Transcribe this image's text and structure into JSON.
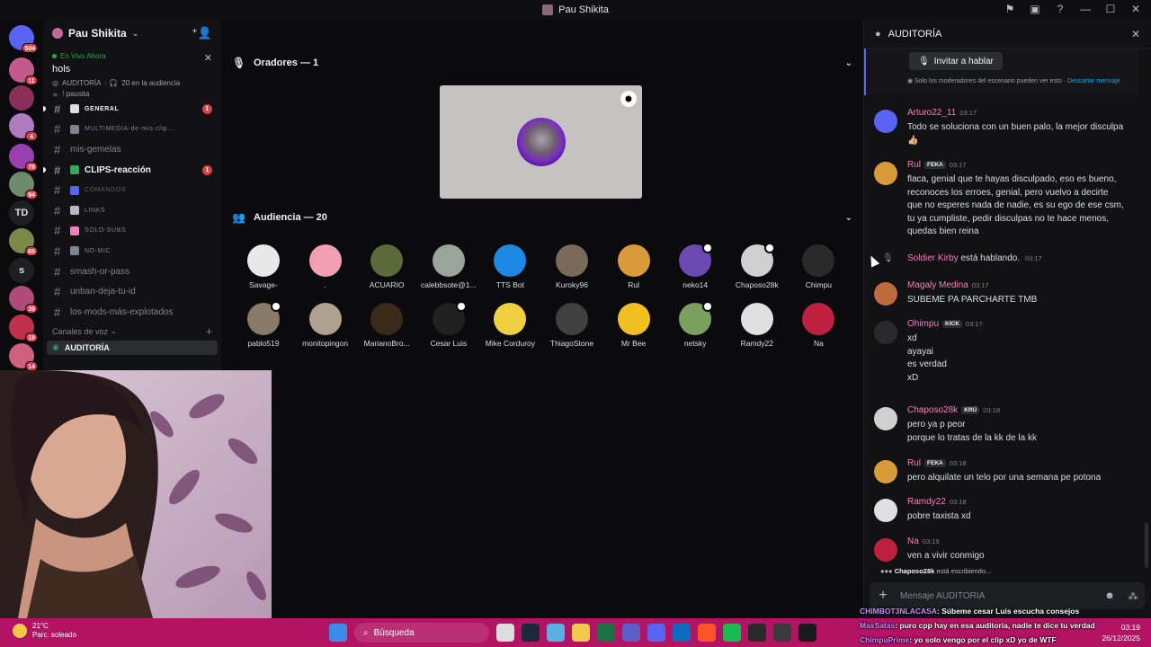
{
  "window": {
    "title": "Pau Shikita"
  },
  "rail": {
    "items": [
      {
        "name": "home",
        "badge": "504",
        "color": "#5865f2"
      },
      {
        "name": "server-1",
        "badge": "11",
        "color": "#c35b8a"
      },
      {
        "name": "server-2",
        "badge": "",
        "color": "#8a2e5a"
      },
      {
        "name": "server-3",
        "badge": "4",
        "color": "#b07ac0"
      },
      {
        "name": "server-4",
        "badge": "78",
        "color": "#9a3fb0"
      },
      {
        "name": "server-5",
        "badge": "94",
        "color": "#6d8a6a"
      },
      {
        "name": "server-td",
        "badge": "",
        "label": "TD",
        "color": "#1f1f23"
      },
      {
        "name": "server-6",
        "badge": "65",
        "color": "#7a8a4a"
      },
      {
        "name": "server-s",
        "badge": "",
        "label": "s",
        "color": "#1f1f23"
      },
      {
        "name": "server-7",
        "badge": "39",
        "color": "#b04a7a"
      },
      {
        "name": "server-8",
        "badge": "19",
        "color": "#c0304a"
      },
      {
        "name": "server-9",
        "badge": "14",
        "color": "#d06080"
      }
    ]
  },
  "sidebar": {
    "server_name": "Pau Shikita",
    "live_label": "En Vivo Ahora",
    "stage_title": "hols",
    "stage_channel": "AUDITORÍA",
    "stage_audience": "20 en la audiencia",
    "stage_status": "! pausita",
    "channels": [
      {
        "label": "GENERAL",
        "style": "small bright",
        "icon_color": "#dbdee1",
        "unread": "1"
      },
      {
        "label": "MULTIMEDIA-de-mis-clip...",
        "style": "small",
        "icon_color": "#80848e",
        "unread": ""
      },
      {
        "label": "mis-gemelas",
        "style": "",
        "icon_color": "",
        "unread": ""
      },
      {
        "label": "CLIPS-reacción",
        "style": "bright",
        "icon_color": "#3ba55c",
        "unread": "1"
      },
      {
        "label": "COMANDOS",
        "style": "small dim",
        "icon_color": "#5865f2",
        "unread": ""
      },
      {
        "label": "LINKS",
        "style": "small",
        "icon_color": "#b5bac1",
        "unread": ""
      },
      {
        "label": "SOLO-SUBS",
        "style": "small",
        "icon_color": "#f47fbf",
        "unread": ""
      },
      {
        "label": "NO-MIC",
        "style": "small",
        "icon_color": "#80848e",
        "unread": ""
      },
      {
        "label": "smash-or-pass",
        "style": "",
        "icon_color": "",
        "unread": ""
      },
      {
        "label": "unban-deja-tu-id",
        "style": "",
        "icon_color": "",
        "unread": ""
      },
      {
        "label": "los-mods-más-explotados",
        "style": "",
        "icon_color": "",
        "unread": ""
      }
    ],
    "voice_header": "Canales de voz",
    "voice_channel": "AUDITORÍA"
  },
  "stage": {
    "speakers_label": "Oradores — 1",
    "audience_label": "Audiencia — 20",
    "audience": [
      {
        "name": "Savage-",
        "color": "#e8e8e8",
        "mod": false
      },
      {
        "name": ".",
        "color": "#f0a0b0",
        "mod": false
      },
      {
        "name": "ACUARIO",
        "color": "#5a6a3a",
        "mod": false
      },
      {
        "name": "calebbsote@1...",
        "color": "#9aa59a",
        "mod": false
      },
      {
        "name": "TTS Bot",
        "color": "#1e88e5",
        "mod": false
      },
      {
        "name": "Kuroky96",
        "color": "#7a6a5a",
        "mod": false
      },
      {
        "name": "Rul",
        "color": "#d99a3a",
        "mod": false
      },
      {
        "name": "neko14",
        "color": "#6a4ab0",
        "mod": true
      },
      {
        "name": "Chaposo28k",
        "color": "#d0d0d0",
        "mod": true
      },
      {
        "name": "Chimpu",
        "color": "#2a2a2a",
        "mod": false
      },
      {
        "name": "pablo519",
        "color": "#8a7a6a",
        "mod": true
      },
      {
        "name": "monitopingon",
        "color": "#b0a090",
        "mod": false
      },
      {
        "name": "MarianoBro...",
        "color": "#3a2a1a",
        "mod": false
      },
      {
        "name": "Cesar Luis",
        "color": "#202020",
        "mod": true
      },
      {
        "name": "Mike Corduroy",
        "color": "#f0d040",
        "mod": false
      },
      {
        "name": "ThiagoStone",
        "color": "#404040",
        "mod": false
      },
      {
        "name": "Mr Bee",
        "color": "#f0c020",
        "mod": false
      },
      {
        "name": "netsky",
        "color": "#7aa060",
        "mod": true
      },
      {
        "name": "Ramdy22",
        "color": "#e0e0e0",
        "mod": false
      },
      {
        "name": "Na",
        "color": "#c02040",
        "mod": false
      }
    ]
  },
  "chat": {
    "header": "AUDITORÍA",
    "invite_label": "Invitar a hablar",
    "invite_note": "Solo los moderadores del escenario pueden ver esto · ",
    "invite_dismiss": "Descartar mensaje",
    "messages": [
      {
        "author": "Arturo22_11",
        "tag": "",
        "time": "03:17",
        "lines": [
          "Todo se soluciona con un buen palo, la mejor disculpa",
          "👍🏼"
        ],
        "color": "#5865f2"
      },
      {
        "author": "Rul",
        "tag": "FEKA",
        "time": "03:17",
        "lines": [
          "flaca, genial que te hayas disculpado, eso es bueno,",
          "reconoces los erroes, genial, pero vuelvo a decirte",
          "que no esperes nada de nadie, es su ego de ese csm,",
          "tu ya cumpliste, pedir disculpas no te hace menos,",
          "quedas bien reina"
        ],
        "color": "#d99a3a"
      },
      {
        "author": "Magaly Medina",
        "tag": "",
        "time": "03:17",
        "lines": [
          "SUBEME PA PARCHARTE TMB"
        ],
        "color": "#c06a40"
      },
      {
        "author": "Ohimpu",
        "tag": "KICK",
        "time": "03:17",
        "lines": [
          "xd",
          "ayayai",
          "es verdad",
          "xD"
        ],
        "color": "#2a2a2a"
      },
      {
        "author": "Chaposo28k",
        "tag": "KRÜ",
        "time": "03:18",
        "lines": [
          "pero ya p peor",
          "porque lo tratas de la kk de la kk"
        ],
        "color": "#d0d0d0"
      },
      {
        "author": "Rul",
        "tag": "FEKA",
        "time": "03:18",
        "lines": [
          "pero alquilate un telo por una semana pe potona"
        ],
        "color": "#d99a3a"
      },
      {
        "author": "Ramdy22",
        "tag": "",
        "time": "03:18",
        "lines": [
          "pobre taxista xd"
        ],
        "color": "#e0e0e0"
      },
      {
        "author": "Na",
        "tag": "",
        "time": "03:19",
        "lines": [
          "ven a vivir conmigo"
        ],
        "color": "#c02040"
      }
    ],
    "system": {
      "name": "Soldier Kirby",
      "text": "está hablando.",
      "time": "03:17"
    },
    "typing_name": "Chaposo28k",
    "typing_text": "está escribiendo...",
    "composer_placeholder": "Mensaje AUDITORÍA"
  },
  "taskbar": {
    "temp": "21°C",
    "weather": "Parc. soleado",
    "search": "Búsqueda",
    "time": "03:19",
    "date": "26/12/2025"
  },
  "overlay": [
    {
      "name": "CHIMBOT3NLACASA",
      "text": ": Súbeme cesar Luis escucha consejos"
    },
    {
      "name": "MaxSatas",
      "text": ": puro cpp hay en esa auditoria, nadie te dice tu verdad"
    },
    {
      "name": "ChimpuPrime",
      "text": ": yo solo vengo por el clip xD yo de WTF"
    }
  ]
}
